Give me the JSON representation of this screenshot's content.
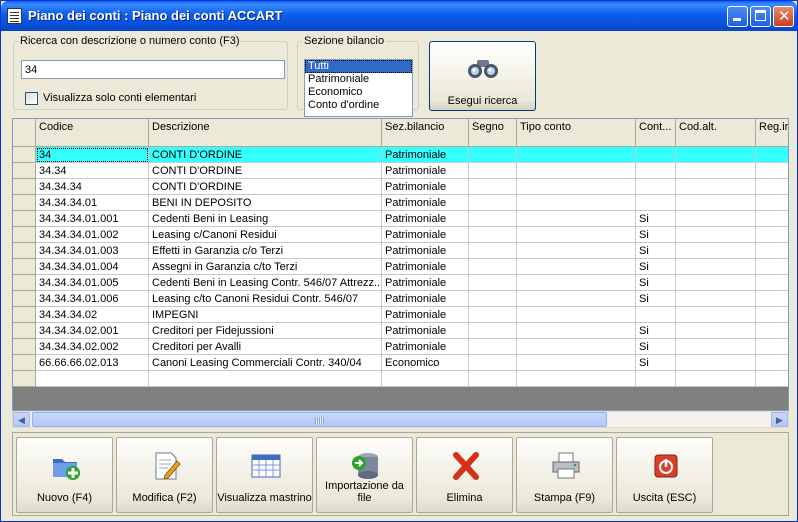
{
  "window": {
    "title": "Piano dei conti : Piano dei conti ACCART"
  },
  "search": {
    "legend": "Ricerca con descrizione o numero conto (F3)",
    "value": "34",
    "only_elementary_label": "Visualizza solo conti elementari",
    "only_elementary_checked": false
  },
  "sezione": {
    "legend": "Sezione bilancio",
    "options": [
      "Tutti",
      "Patrimoniale",
      "Economico",
      "Conto d'ordine"
    ],
    "selected": "Tutti"
  },
  "search_button": {
    "label": "Esegui ricerca",
    "icon": "binoculars-icon"
  },
  "grid": {
    "columns": [
      "Codice",
      "Descrizione",
      "Sez.bilancio",
      "Segno",
      "Tipo conto",
      "Cont...",
      "Cod.alt.",
      "Reg.ir"
    ],
    "rows": [
      [
        "34",
        "CONTI D'ORDINE",
        "Patrimoniale",
        "",
        "",
        "",
        "",
        ""
      ],
      [
        "34.34",
        "CONTI D'ORDINE",
        "Patrimoniale",
        "",
        "",
        "",
        "",
        ""
      ],
      [
        "34.34.34",
        "CONTI D'ORDINE",
        "Patrimoniale",
        "",
        "",
        "",
        "",
        ""
      ],
      [
        "34.34.34.01",
        "BENI IN DEPOSITO",
        "Patrimoniale",
        "",
        "",
        "",
        "",
        ""
      ],
      [
        "34.34.34.01.001",
        "Cedenti Beni in Leasing",
        "Patrimoniale",
        "",
        "",
        "Si",
        "",
        ""
      ],
      [
        "34.34.34.01.002",
        "Leasing c/Canoni Residui",
        "Patrimoniale",
        "",
        "",
        "Si",
        "",
        ""
      ],
      [
        "34.34.34.01.003",
        "Effetti in Garanzia c/o Terzi",
        "Patrimoniale",
        "",
        "",
        "Si",
        "",
        ""
      ],
      [
        "34.34.34.01.004",
        "Assegni in Garanzia c/to Terzi",
        "Patrimoniale",
        "",
        "",
        "Si",
        "",
        ""
      ],
      [
        "34.34.34.01.005",
        "Cedenti Beni in Leasing Contr. 546/07 Attrezz...",
        "Patrimoniale",
        "",
        "",
        "Si",
        "",
        ""
      ],
      [
        "34.34.34.01.006",
        "Leasing c/to Canoni Residui Contr. 546/07",
        "Patrimoniale",
        "",
        "",
        "Si",
        "",
        ""
      ],
      [
        "34.34.34.02",
        "IMPEGNI",
        "Patrimoniale",
        "",
        "",
        "",
        "",
        ""
      ],
      [
        "34.34.34.02.001",
        "Creditori per Fidejussioni",
        "Patrimoniale",
        "",
        "",
        "Si",
        "",
        ""
      ],
      [
        "34.34.34.02.002",
        "Creditori per Avalli",
        "Patrimoniale",
        "",
        "",
        "Si",
        "",
        ""
      ],
      [
        "66.66.66.02.013",
        "Canoni Leasing Commerciali Contr. 340/04",
        "Economico",
        "",
        "",
        "Si",
        "",
        ""
      ],
      [
        "",
        "",
        "",
        "",
        "",
        "",
        "",
        ""
      ]
    ],
    "current_row": 0,
    "current_row_color": "#33ffff"
  },
  "actions": [
    {
      "id": "nuovo",
      "label": "Nuovo (F4)",
      "icon": "new-folder-icon"
    },
    {
      "id": "modifica",
      "label": "Modifica (F2)",
      "icon": "edit-document-icon"
    },
    {
      "id": "mastrino",
      "label": "Visualizza mastrino",
      "icon": "calendar-grid-icon"
    },
    {
      "id": "import",
      "label": "Importazione da file",
      "icon": "database-import-icon"
    },
    {
      "id": "elimina",
      "label": "Elimina",
      "icon": "delete-x-icon"
    },
    {
      "id": "stampa",
      "label": "Stampa (F9)",
      "icon": "printer-icon"
    },
    {
      "id": "uscita",
      "label": "Uscita (ESC)",
      "icon": "power-exit-icon"
    }
  ]
}
